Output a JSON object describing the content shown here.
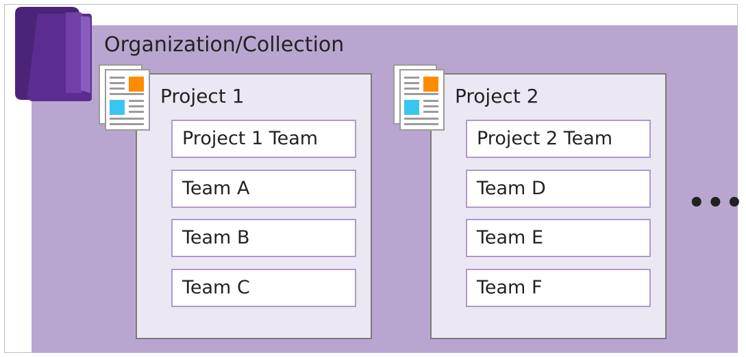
{
  "organization": {
    "title": "Organization/Collection"
  },
  "projects": [
    {
      "title": "Project 1",
      "teams": [
        "Project 1 Team",
        "Team A",
        "Team B",
        "Team C"
      ]
    },
    {
      "title": "Project 2",
      "teams": [
        "Project 2 Team",
        "Team D",
        "Team E",
        "Team F"
      ]
    }
  ],
  "more_indicator": "•••",
  "icons": {
    "organization": "folder-icon",
    "project": "document-icon"
  },
  "colors": {
    "org_background": "#b8a6d0",
    "project_background": "#ece8f3",
    "team_border": "#b098cc",
    "folder": "#5c2d91",
    "doc_orange": "#ff8c00",
    "doc_blue": "#3bc4f0"
  }
}
